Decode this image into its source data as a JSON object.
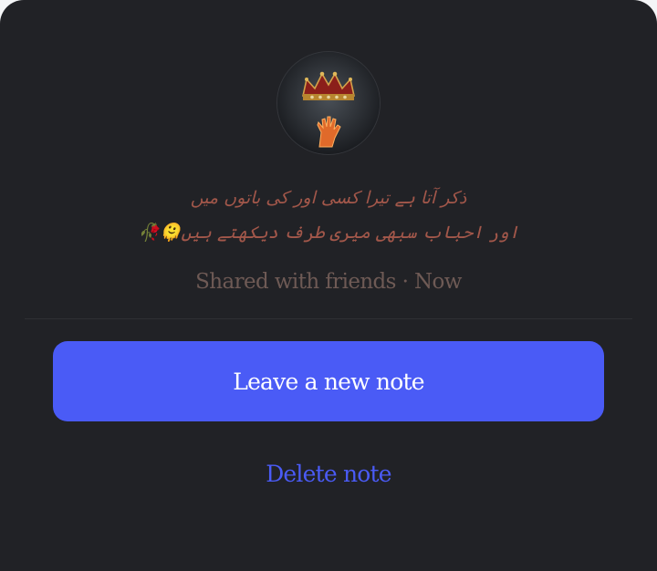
{
  "note": {
    "avatar_icon": "crown-and-hand-avatar",
    "line1": "ذکر آتا ہے تیرا کسی اور کی باتوں میں",
    "line2": "اور احباب سبھی میری طرف دیکھتے ہیں🫠🥀",
    "meta": "Shared with friends · Now"
  },
  "actions": {
    "primary_label": "Leave a new note",
    "secondary_label": "Delete note"
  },
  "colors": {
    "sheet_background": "#212226",
    "accent": "#4a5bf6",
    "note_text": "#a2574a",
    "meta_text": "#6e5a55"
  }
}
